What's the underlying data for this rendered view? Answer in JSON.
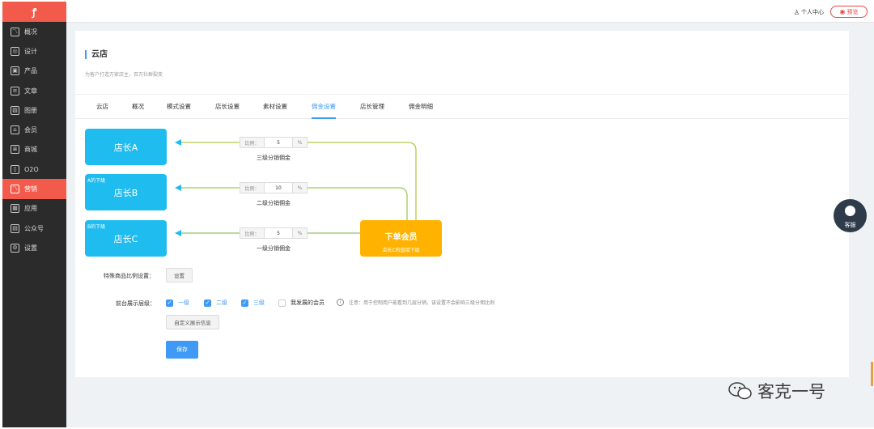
{
  "sidebar": {
    "logo": "ꝭ",
    "items": [
      {
        "label": "概况",
        "icon": "trend-icon",
        "glyph": "〽",
        "active": false
      },
      {
        "label": "设计",
        "icon": "palette-icon",
        "glyph": "◎",
        "active": false
      },
      {
        "label": "产品",
        "icon": "box-icon",
        "glyph": "▣",
        "active": false
      },
      {
        "label": "文章",
        "icon": "document-icon",
        "glyph": "≡",
        "active": false
      },
      {
        "label": "图册",
        "icon": "image-icon",
        "glyph": "▨",
        "active": false
      },
      {
        "label": "会员",
        "icon": "user-icon",
        "glyph": "⌂",
        "active": false
      },
      {
        "label": "商城",
        "icon": "clipboard-icon",
        "glyph": "≣",
        "active": false
      },
      {
        "label": "O2O",
        "icon": "store-icon",
        "glyph": "▯",
        "active": false
      },
      {
        "label": "营销",
        "icon": "marketing-icon",
        "glyph": "〽",
        "active": true
      },
      {
        "label": "应用",
        "icon": "apps-icon",
        "glyph": "▦",
        "active": false
      },
      {
        "label": "公众号",
        "icon": "id-card-icon",
        "glyph": "▤",
        "active": false
      },
      {
        "label": "设置",
        "icon": "gear-icon",
        "glyph": "⚙",
        "active": false
      }
    ]
  },
  "topbar": {
    "user_center": "个人中心",
    "preview": "预览"
  },
  "page": {
    "title": "云店",
    "subtitle": "为客户打造万家店主，百万社群裂变"
  },
  "tabs": [
    {
      "label": "云店",
      "active": false
    },
    {
      "label": "概况",
      "active": false
    },
    {
      "label": "模式设置",
      "active": false
    },
    {
      "label": "店长设置",
      "active": false
    },
    {
      "label": "素材设置",
      "active": false
    },
    {
      "label": "佣金设置",
      "active": true
    },
    {
      "label": "店长管理",
      "active": false
    },
    {
      "label": "佣金明细",
      "active": false
    }
  ],
  "commission": {
    "stores": [
      {
        "name": "店长A",
        "sub": "",
        "ratio_label": "比例：",
        "ratio": "5",
        "unit": "%",
        "level": "三级分销佣金"
      },
      {
        "name": "店长B",
        "sub": "A的下级",
        "ratio_label": "比例：",
        "ratio": "10",
        "unit": "%",
        "level": "二级分销佣金"
      },
      {
        "name": "店长C",
        "sub": "B的下级",
        "ratio_label": "比例：",
        "ratio": "5",
        "unit": "%",
        "level": "一级分销佣金"
      }
    ],
    "buyer": {
      "title": "下单会员",
      "sub": "店长C的直接下级"
    },
    "colors": {
      "store": "#1fbcf0",
      "buyer": "#ffb300",
      "accent": "#3f9af5"
    }
  },
  "form": {
    "special_label": "特殊商品比例设置：",
    "special_button": "设置",
    "display_label": "前台展示层级：",
    "levels": [
      {
        "label": "一级",
        "checked": true
      },
      {
        "label": "二级",
        "checked": true
      },
      {
        "label": "三级",
        "checked": true
      },
      {
        "label": "我发展的会员",
        "checked": false
      }
    ],
    "note": "注意：用于控制用户能看到几层分销，该设置不会影响三级分佣比例",
    "custom_button": "自定义展示信息",
    "save": "保存"
  },
  "service": {
    "label": "客服"
  },
  "watermark": {
    "text": "客克一号"
  }
}
